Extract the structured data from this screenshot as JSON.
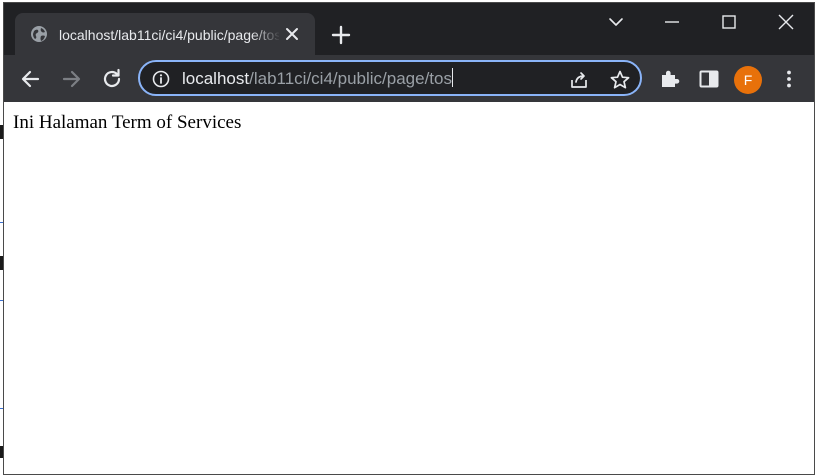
{
  "browser": {
    "tab": {
      "title": "localhost/lab11ci/ci4/public/page/tos",
      "favicon": "globe-icon"
    },
    "address_bar": {
      "host": "localhost",
      "path": "/lab11ci/ci4/public/page/tos",
      "security_icon": "info-icon"
    },
    "profile": {
      "initial": "F",
      "color": "#e8710a"
    }
  },
  "page": {
    "heading": "Ini Halaman Term of Services"
  },
  "theme": {
    "tabbar_bg": "#202124",
    "toolbar_bg": "#35363a",
    "omnibox_border": "#8ab4f8"
  }
}
